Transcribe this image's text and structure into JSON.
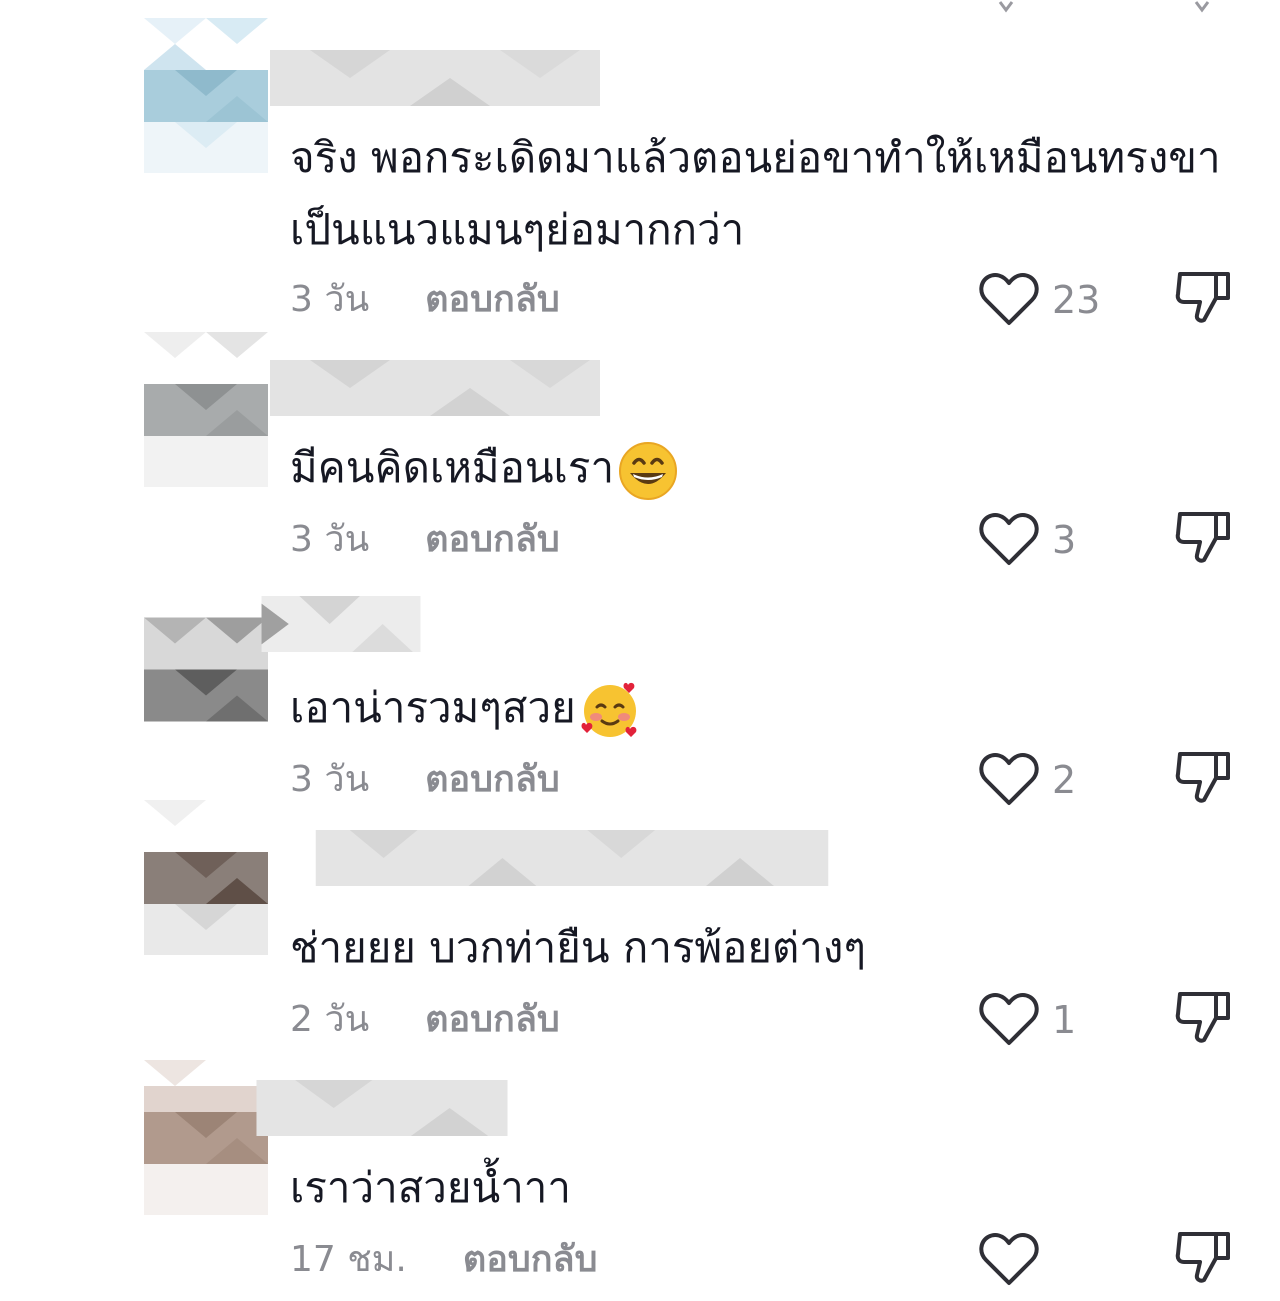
{
  "comments": [
    {
      "text": "จริง พอกระเดิดมาแล้วตอนย่อขาทำให้เหมือนทรงขาเป็นแนวแมนๆย่อมากกว่า",
      "time": "3 วัน",
      "reply_label": "ตอบกลับ",
      "like_count": "23",
      "emoji": ""
    },
    {
      "text": "มีคนคิดเหมือนเรา",
      "time": "3 วัน",
      "reply_label": "ตอบกลับ",
      "like_count": "3",
      "emoji": "grinning-face-emoji"
    },
    {
      "text": "เอาน่ารวมๆสวย",
      "time": "3 วัน",
      "reply_label": "ตอบกลับ",
      "like_count": "2",
      "emoji": "smiling-face-with-hearts-emoji"
    },
    {
      "text": "ช่ายยย บวกท่ายืน การพ้อยต่างๆ",
      "time": "2 วัน",
      "reply_label": "ตอบกลับ",
      "like_count": "1",
      "emoji": ""
    },
    {
      "text": "เราว่าสวยน้ำาา",
      "time": "17 ชม.",
      "reply_label": "ตอบกลับ",
      "like_count": "",
      "emoji": ""
    }
  ],
  "icons": {
    "like": "heart-outline-icon",
    "dislike": "thumbs-down-icon"
  },
  "colors": {
    "text": "#161823",
    "secondary": "#8a8b91",
    "icon": "#2f2f36",
    "background": "#ffffff"
  }
}
